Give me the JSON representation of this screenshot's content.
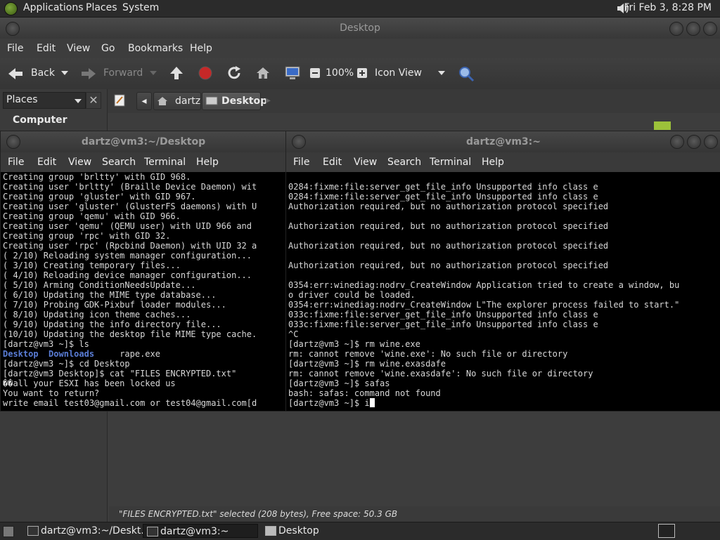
{
  "top_panel": {
    "menus": [
      "Applications",
      "Places",
      "System"
    ],
    "clock": "Fri Feb  3,  8:28 PM"
  },
  "nautilus": {
    "title": "Desktop",
    "menus": [
      "File",
      "Edit",
      "View",
      "Go",
      "Bookmarks",
      "Help"
    ],
    "toolbar": {
      "back": "Back",
      "forward": "Forward",
      "zoom": "100%",
      "view_mode": "Icon View"
    },
    "sidebar": {
      "selector": "Places",
      "first_item": "Computer"
    },
    "breadcrumbs": [
      "dartz",
      "Desktop"
    ],
    "status": "\"FILES ENCRYPTED.txt\" selected (208 bytes), Free space: 50.3 GB"
  },
  "term_left": {
    "title": "dartz@vm3:~/Desktop",
    "menus": [
      "File",
      "Edit",
      "View",
      "Search",
      "Terminal",
      "Help"
    ],
    "lines": [
      "Creating group 'brltty' with GID 968.",
      "Creating user 'brltty' (Braille Device Daemon) wit",
      "Creating group 'gluster' with GID 967.",
      "Creating user 'gluster' (GlusterFS daemons) with U",
      "Creating group 'qemu' with GID 966.",
      "Creating user 'qemu' (QEMU user) with UID 966 and",
      "Creating group 'rpc' with GID 32.",
      "Creating user 'rpc' (Rpcbind Daemon) with UID 32 a",
      "( 2/10) Reloading system manager configuration...",
      "( 3/10) Creating temporary files...",
      "( 4/10) Reloading device manager configuration...",
      "( 5/10) Arming ConditionNeedsUpdate...",
      "( 6/10) Updating the MIME type database...",
      "( 7/10) Probing GDK-Pixbuf loader modules...",
      "( 8/10) Updating icon theme caches...",
      "( 9/10) Updating the info directory file...",
      "(10/10) Updating the desktop file MIME type cache.",
      "[dartz@vm3 ~]$ ls"
    ],
    "ls_output": {
      "dir1": "Desktop",
      "dir2": "Downloads",
      "file": "rape.exe"
    },
    "lines_after": [
      "[dartz@vm3 ~]$ cd Desktop",
      "[dartz@vm3 Desktop]$ cat \"FILES ENCRYPTED.txt\"",
      "��all your ESXI has been locked us",
      "You want to return?",
      "write email test03@gmail.com or test04@gmail.com[d"
    ]
  },
  "term_right": {
    "title": "dartz@vm3:~",
    "menus": [
      "File",
      "Edit",
      "View",
      "Search",
      "Terminal",
      "Help"
    ],
    "lines": [
      "0284:fixme:file:server_get_file_info Unsupported info class e",
      "0284:fixme:file:server_get_file_info Unsupported info class e",
      "Authorization required, but no authorization protocol specified",
      "",
      "Authorization required, but no authorization protocol specified",
      "",
      "Authorization required, but no authorization protocol specified",
      "",
      "Authorization required, but no authorization protocol specified",
      "",
      "0354:err:winediag:nodrv_CreateWindow Application tried to create a window, bu",
      "o driver could be loaded.",
      "0354:err:winediag:nodrv_CreateWindow L\"The explorer process failed to start.\"",
      "033c:fixme:file:server_get_file_info Unsupported info class e",
      "033c:fixme:file:server_get_file_info Unsupported info class e",
      "^C",
      "[dartz@vm3 ~]$ rm wine.exe",
      "rm: cannot remove 'wine.exe': No such file or directory",
      "[dartz@vm3 ~]$ rm wine.exasdafe",
      "rm: cannot remove 'wine.exasdafe': No such file or directory",
      "[dartz@vm3 ~]$ safas",
      "bash: safas: command not found"
    ],
    "prompt": "[dartz@vm3 ~]$ i"
  },
  "taskbar": {
    "tasks": [
      "dartz@vm3:~/Deskt...",
      "dartz@vm3:~",
      "Desktop"
    ]
  },
  "colors": {
    "panel": "#2b2b2b",
    "terminal_bg": "#000000",
    "directory_blue": "#5a7dd6"
  },
  "icons": [
    "gnome-foot-icon",
    "speaker-icon",
    "back-arrow-icon",
    "forward-arrow-icon",
    "up-arrow-icon",
    "stop-icon",
    "reload-icon",
    "home-icon",
    "computer-icon",
    "zoom-out-icon",
    "zoom-in-icon",
    "search-icon",
    "edit-icon",
    "folder-icon",
    "terminal-icon"
  ]
}
